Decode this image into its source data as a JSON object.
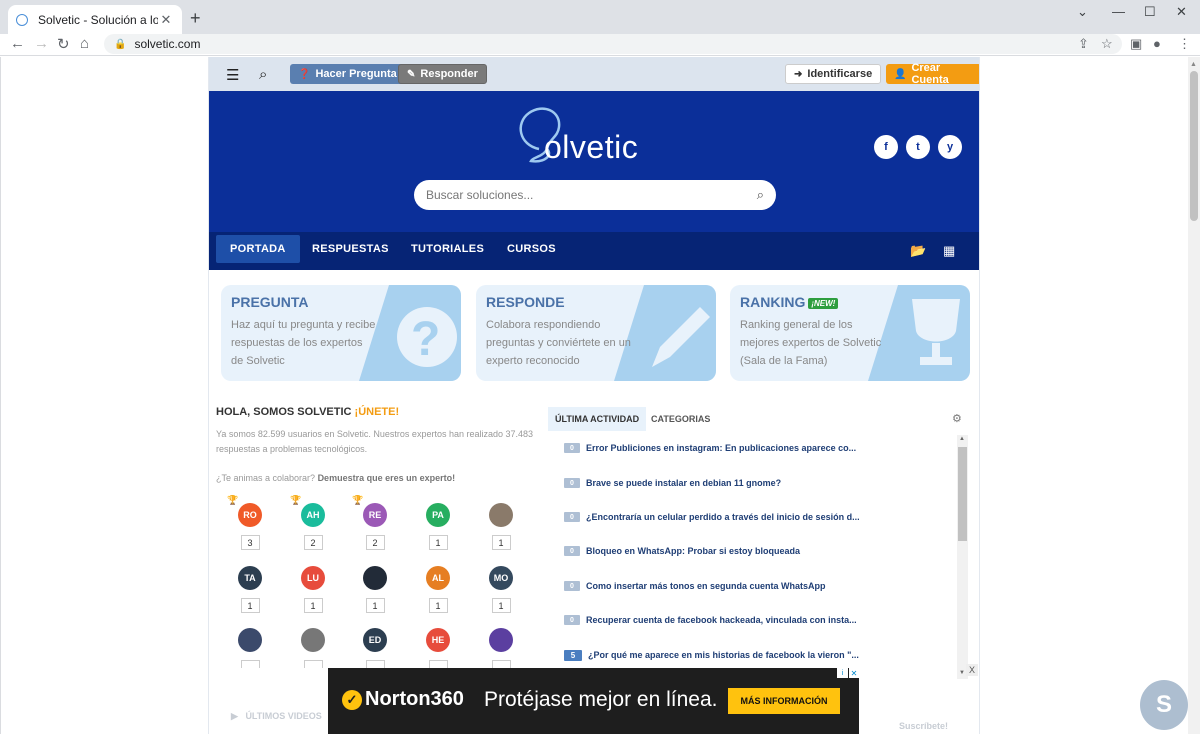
{
  "browser": {
    "tab_title": "Solvetic - Solución a los problem",
    "url": "solvetic.com"
  },
  "topbar": {
    "ask_label": "Hacer Pregunta",
    "answer_label": "Responder",
    "login_label": "Identificarse",
    "signup_label": "Crear Cuenta"
  },
  "hero": {
    "logo_text": "olvetic",
    "search_placeholder": "Buscar soluciones...",
    "social": [
      "f",
      "t",
      "y"
    ]
  },
  "nav": {
    "items": [
      "PORTADA",
      "RESPUESTAS",
      "TUTORIALES",
      "CURSOS"
    ]
  },
  "cards": [
    {
      "title": "PREGUNTA",
      "desc": "Haz aquí tu pregunta y recibe respuestas de los expertos de Solvetic"
    },
    {
      "title": "RESPONDE",
      "desc": "Colabora respondiendo preguntas y conviértete en un experto reconocido"
    },
    {
      "title": "RANKING",
      "badge": "¡NEW!",
      "desc": "Ranking general de los mejores expertos de Solvetic (Sala de la Fama)"
    }
  ],
  "community": {
    "hello": "HOLA, SOMOS SOLVETIC ",
    "join": "¡ÚNETE!",
    "stats": "Ya somos 82.599 usuarios en Solvetic. Nuestros expertos han realizado 37.483 respuestas a problemas tecnológicos.",
    "invite_prefix": "¿Te animas a colaborar? ",
    "invite_bold": "Demuestra que eres un experto!",
    "users": [
      {
        "initials": "RO",
        "color": "#f05a28",
        "count": "3",
        "trophy": "gold"
      },
      {
        "initials": "AH",
        "color": "#1abc9c",
        "count": "2",
        "trophy": "silver"
      },
      {
        "initials": "RE",
        "color": "#9b59b6",
        "count": "2",
        "trophy": "bronze"
      },
      {
        "initials": "PA",
        "color": "#27ae60",
        "count": "1"
      },
      {
        "initials": "",
        "color": "#8a7a6a",
        "count": "1"
      },
      {
        "initials": "TA",
        "color": "#2c3e50",
        "count": "1"
      },
      {
        "initials": "LU",
        "color": "#e74c3c",
        "count": "1"
      },
      {
        "initials": "",
        "color": "#222b38",
        "count": "1"
      },
      {
        "initials": "AL",
        "color": "#e67e22",
        "count": "1"
      },
      {
        "initials": "MO",
        "color": "#34495e",
        "count": "1"
      },
      {
        "initials": "",
        "color": "#3b4a6b",
        "count": ""
      },
      {
        "initials": "",
        "color": "#777",
        "count": ""
      },
      {
        "initials": "ED",
        "color": "#2c3e50",
        "count": ""
      },
      {
        "initials": "HE",
        "color": "#e74c3c",
        "count": ""
      },
      {
        "initials": "",
        "color": "#5b3fa0",
        "count": ""
      }
    ]
  },
  "activity": {
    "tabs": [
      "ÚLTIMA ACTIVIDAD",
      "CATEGORIAS"
    ],
    "items": [
      {
        "num": "0",
        "text": "Error Publiciones en instagram: En publicaciones aparece co..."
      },
      {
        "num": "0",
        "text": "Brave se puede instalar en debian 11 gnome?"
      },
      {
        "num": "0",
        "text": "¿Encontraría un celular perdido a través del inicio de sesión d..."
      },
      {
        "num": "0",
        "text": "Bloqueo en WhatsApp: Probar si estoy bloqueada"
      },
      {
        "num": "0",
        "text": "Como insertar más tonos en segunda cuenta WhatsApp"
      },
      {
        "num": "0",
        "text": "Recuperar cuenta de facebook hackeada, vinculada con insta..."
      },
      {
        "num": "5",
        "text": "¿Por qué me aparece en mis historias de facebook la vieron \"..."
      }
    ]
  },
  "ad": {
    "brand": "Norton360",
    "slogan": "Protéjase mejor en línea.",
    "cta": "MÁS INFORMACIÓN"
  },
  "footer": {
    "videos": "ÚLTIMOS VIDEOS",
    "subscribe": "Suscríbete!"
  }
}
